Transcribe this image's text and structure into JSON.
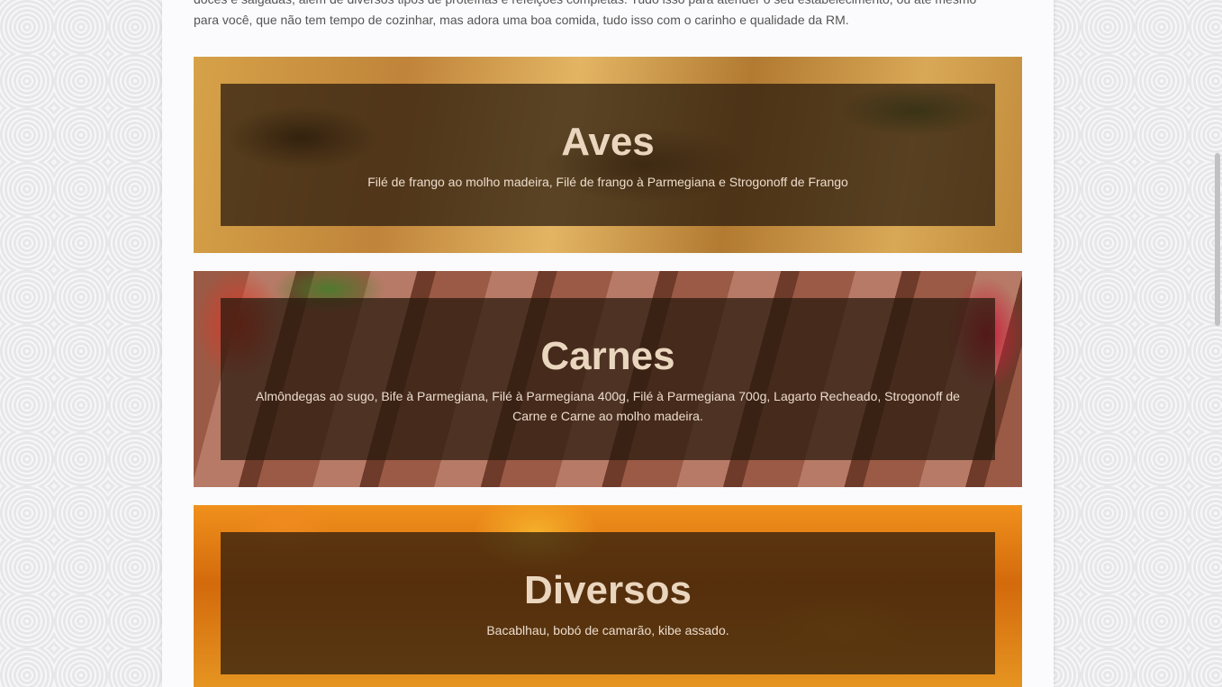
{
  "intro": {
    "line1": "doces e salgadas, além de diversos tipos de proteínas e refeições completas. Tudo isso para atender o seu estabelecimento, ou até mesmo",
    "line2": "para você, que não tem tempo de cozinhar, mas adora uma boa comida, tudo isso com o carinho e qualidade da RM."
  },
  "categories": [
    {
      "title": "Aves",
      "description": "Filé de frango ao molho madeira, Filé de frango à Parmegiana e Strogonoff de Frango"
    },
    {
      "title": "Carnes",
      "description": "Almôndegas ao sugo, Bife à Parmegiana, Filé à Parmegiana 400g, Filé à Parmegiana 700g, Lagarto Recheado, Strogonoff de Carne e Carne ao molho madeira."
    },
    {
      "title": "Diversos",
      "description": "Bacablhau, bobó de camarão, kibe assado."
    }
  ],
  "colors": {
    "overlay": "#26180c",
    "title_text": "#ead6bf",
    "page_background": "#fbfbfd"
  }
}
